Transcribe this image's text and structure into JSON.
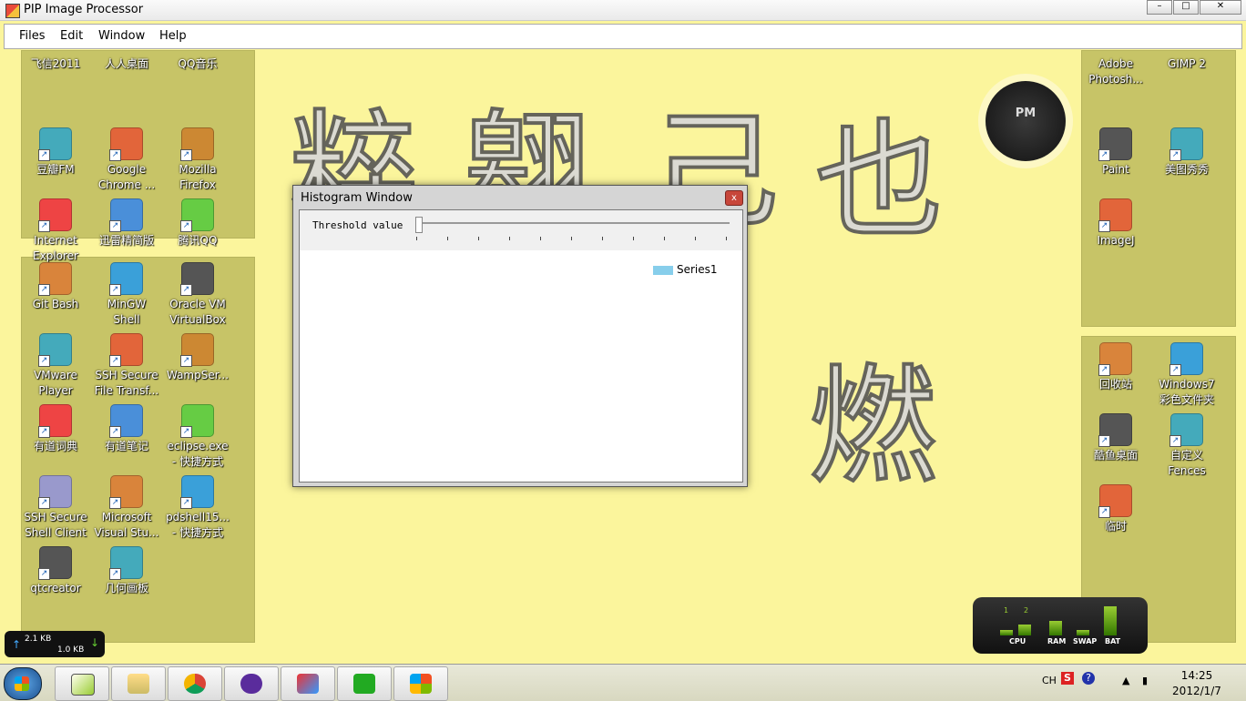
{
  "app": {
    "title": "PIP Image Processor",
    "menu": [
      "Files",
      "Edit",
      "Window",
      "Help"
    ],
    "window_controls": [
      "–",
      "□",
      "✕"
    ]
  },
  "desktop": {
    "left_top_icons": [
      {
        "label": "飞信2011",
        "icon": "fetion-icon"
      },
      {
        "label": "人人桌面",
        "icon": "renren-icon"
      },
      {
        "label": "QQ音乐",
        "icon": "qq-music-icon"
      },
      {
        "label": "豆瓣FM",
        "icon": "douban-fm-icon"
      },
      {
        "label": "Google\nChrome ...",
        "icon": "chrome-icon"
      },
      {
        "label": "Mozilla\nFirefox",
        "icon": "firefox-icon"
      },
      {
        "label": "Internet\nExplorer",
        "icon": "ie-icon"
      },
      {
        "label": "迅雷精简版",
        "icon": "thunder-icon"
      },
      {
        "label": "腾讯QQ",
        "icon": "qq-icon"
      }
    ],
    "left_bottom_icons": [
      {
        "label": "Git Bash",
        "icon": "git-icon"
      },
      {
        "label": "MinGW\nShell",
        "icon": "mingw-icon"
      },
      {
        "label": "Oracle VM\nVirtualBox",
        "icon": "virtualbox-icon"
      },
      {
        "label": "VMware\nPlayer",
        "icon": "vmware-icon"
      },
      {
        "label": "SSH Secure\nFile Transf...",
        "icon": "ssh-file-icon"
      },
      {
        "label": "WampSer...",
        "icon": "wamp-icon"
      },
      {
        "label": "有道词典",
        "icon": "youdao-dict-icon"
      },
      {
        "label": "有道笔记",
        "icon": "youdao-note-icon"
      },
      {
        "label": "eclipse.exe\n- 快捷方式",
        "icon": "eclipse-icon"
      },
      {
        "label": "SSH Secure\nShell Client",
        "icon": "ssh-client-icon"
      },
      {
        "label": "Microsoft\nVisual Stu...",
        "icon": "visual-studio-icon"
      },
      {
        "label": "pdshell15...\n- 快捷方式",
        "icon": "pdshell-icon"
      },
      {
        "label": "qtcreator",
        "icon": "qt-icon"
      },
      {
        "label": "几何画板",
        "icon": "geometry-icon"
      }
    ],
    "right_top_icons": [
      {
        "label": "Adobe\nPhotosh...",
        "icon": "photoshop-icon"
      },
      {
        "label": "GIMP 2",
        "icon": "gimp-icon"
      },
      {
        "label": "Paint",
        "icon": "paint-icon"
      },
      {
        "label": "美图秀秀",
        "icon": "meitu-icon"
      },
      {
        "label": "ImageJ",
        "icon": "imagej-icon"
      }
    ],
    "right_bottom_icons": [
      {
        "label": "回收站",
        "icon": "recycle-bin-icon"
      },
      {
        "label": "Windows7\n彩色文件夹",
        "icon": "windows7-folder-icon"
      },
      {
        "label": "酷鱼桌面",
        "icon": "kuyu-icon"
      },
      {
        "label": "自定义\nFences",
        "icon": "fences-icon"
      },
      {
        "label": "临时",
        "icon": "folder-icon"
      }
    ],
    "clock_label": "PM"
  },
  "histogram": {
    "title": "Histogram Window",
    "close": "x",
    "threshold_label": "Threshold value",
    "threshold_value": 0,
    "tick_count": 11,
    "legend": "Series1"
  },
  "widgets": {
    "net_up": "2.1 KB",
    "net_down": "1.0 KB",
    "meter_labels": [
      "CPU",
      "RAM",
      "SWAP",
      "BAT"
    ],
    "cores": [
      "1",
      "2"
    ]
  },
  "taskbar": {
    "time": "14:25",
    "date": "2012/1/7",
    "lang": "CH",
    "colors": {
      "accent": "#87ceeb",
      "fence": "#c7c467",
      "desktop": "#fbf59c"
    }
  }
}
